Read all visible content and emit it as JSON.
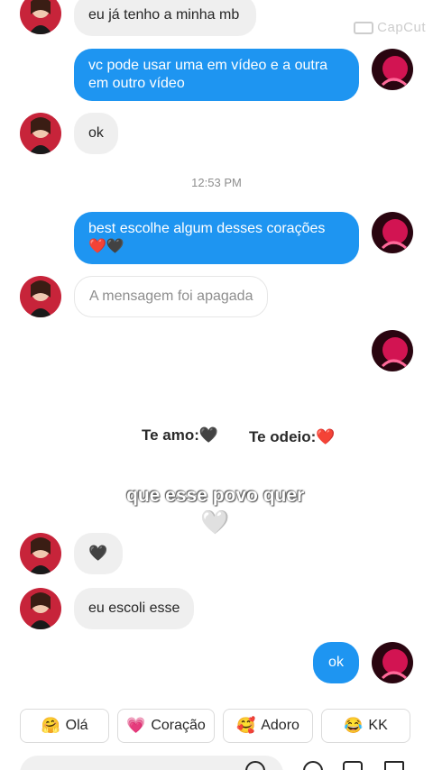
{
  "watermark": "CapCut",
  "messages": [
    {
      "text": "eu já tenho a minha mb"
    },
    {
      "text": "vc pode usar uma em vídeo e a outra em outro vídeo"
    },
    {
      "text": "ok"
    },
    {
      "text": "best escolhe algum desses corações ❤️🖤"
    },
    {
      "text": "A mensagem foi apagada"
    },
    {
      "text": "🖤"
    },
    {
      "text": "eu escoli esse"
    },
    {
      "text": "ok"
    }
  ],
  "timestamp": "12:53 PM",
  "overlay": {
    "te_amo": "Te amo:🖤",
    "te_odeio": "Te odeio:❤️",
    "caption": "que esse povo quer",
    "heart": "🤍"
  },
  "quick_replies": [
    {
      "emoji": "🤗",
      "label": "Olá"
    },
    {
      "emoji": "💗",
      "label": "Coração"
    },
    {
      "emoji": "🥰",
      "label": "Adoro"
    },
    {
      "emoji": "😂",
      "label": "KK"
    }
  ],
  "colors": {
    "sent_bubble": "#1e95f1",
    "received_bubble": "#efefef",
    "background": "#ffffff"
  }
}
